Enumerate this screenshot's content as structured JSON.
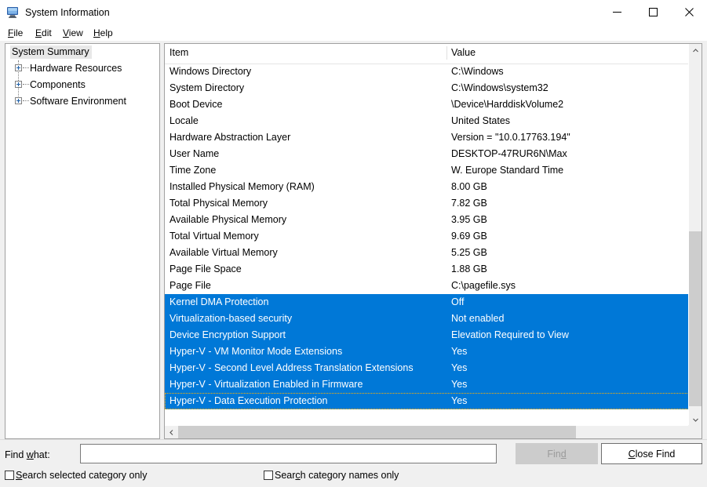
{
  "window": {
    "title": "System Information",
    "icon": "system-information-icon",
    "controls": {
      "minimize": "—",
      "maximize": "☐",
      "close": "✕"
    }
  },
  "menu": {
    "items": [
      {
        "label": "File",
        "accel": "F"
      },
      {
        "label": "Edit",
        "accel": "E"
      },
      {
        "label": "View",
        "accel": "V"
      },
      {
        "label": "Help",
        "accel": "H"
      }
    ]
  },
  "tree": {
    "root": {
      "label": "System Summary",
      "selected": true
    },
    "children": [
      {
        "label": "Hardware Resources",
        "expanded": false
      },
      {
        "label": "Components",
        "expanded": false
      },
      {
        "label": "Software Environment",
        "expanded": false
      }
    ]
  },
  "list": {
    "columns": [
      "Item",
      "Value"
    ],
    "rows": [
      {
        "item": "Windows Directory",
        "value": "C:\\Windows",
        "selected": false
      },
      {
        "item": "System Directory",
        "value": "C:\\Windows\\system32",
        "selected": false
      },
      {
        "item": "Boot Device",
        "value": "\\Device\\HarddiskVolume2",
        "selected": false
      },
      {
        "item": "Locale",
        "value": "United States",
        "selected": false
      },
      {
        "item": "Hardware Abstraction Layer",
        "value": "Version = \"10.0.17763.194\"",
        "selected": false
      },
      {
        "item": "User Name",
        "value": "DESKTOP-47RUR6N\\Max",
        "selected": false
      },
      {
        "item": "Time Zone",
        "value": "W. Europe Standard Time",
        "selected": false
      },
      {
        "item": "Installed Physical Memory (RAM)",
        "value": "8.00 GB",
        "selected": false
      },
      {
        "item": "Total Physical Memory",
        "value": "7.82 GB",
        "selected": false
      },
      {
        "item": "Available Physical Memory",
        "value": "3.95 GB",
        "selected": false
      },
      {
        "item": "Total Virtual Memory",
        "value": "9.69 GB",
        "selected": false
      },
      {
        "item": "Available Virtual Memory",
        "value": "5.25 GB",
        "selected": false
      },
      {
        "item": "Page File Space",
        "value": "1.88 GB",
        "selected": false
      },
      {
        "item": "Page File",
        "value": "C:\\pagefile.sys",
        "selected": false
      },
      {
        "item": "Kernel DMA Protection",
        "value": "Off",
        "selected": true
      },
      {
        "item": "Virtualization-based security",
        "value": "Not enabled",
        "selected": true
      },
      {
        "item": "Device Encryption Support",
        "value": "Elevation Required to View",
        "selected": true
      },
      {
        "item": "Hyper-V - VM Monitor Mode Extensions",
        "value": "Yes",
        "selected": true
      },
      {
        "item": "Hyper-V - Second Level Address Translation Extensions",
        "value": "Yes",
        "selected": true
      },
      {
        "item": "Hyper-V - Virtualization Enabled in Firmware",
        "value": "Yes",
        "selected": true
      },
      {
        "item": "Hyper-V - Data Execution Protection",
        "value": "Yes",
        "selected": true,
        "focused": true
      }
    ],
    "selection_color": "#0078d7",
    "scroll": {
      "vertical": {
        "thumb_top_pct": 49,
        "thumb_height_pct": 49
      },
      "horizontal": {
        "thumb_left_pct": 0,
        "thumb_width_pct": 78
      }
    }
  },
  "find_bar": {
    "label": "Find what:",
    "label_accel": "w",
    "input_value": "",
    "input_placeholder": "",
    "find_button": {
      "label": "Find",
      "accel": "d",
      "enabled": false
    },
    "close_button": {
      "label": "Close Find",
      "accel": "C",
      "enabled": true
    },
    "checkboxes": [
      {
        "label": "Search selected category only",
        "accel": "S",
        "checked": false
      },
      {
        "label": "Search category names only",
        "accel": "c",
        "checked": false
      }
    ]
  }
}
